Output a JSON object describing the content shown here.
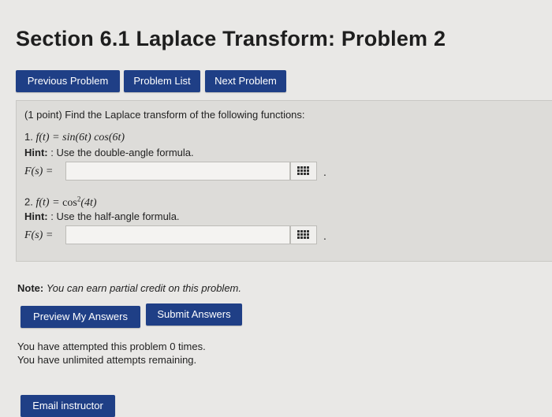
{
  "header": {
    "title": "Section 6.1 Laplace Transform: Problem 2"
  },
  "nav": {
    "previous": "Previous Problem",
    "list": "Problem List",
    "next": "Next Problem"
  },
  "problem": {
    "statement": "(1 point) Find the Laplace transform of the following functions:",
    "parts": [
      {
        "number": "1.",
        "function_lhs": "f(t) =",
        "function_rhs": "sin(6t) cos(6t)",
        "hint_label": "Hint:",
        "hint_text": ": Use the double-angle formula.",
        "answer_label": "F(s) =",
        "answer_value": ""
      },
      {
        "number": "2.",
        "function_lhs": "f(t) =",
        "function_rhs_base": "cos",
        "function_rhs_exp": "2",
        "function_rhs_arg": "(4t)",
        "hint_label": "Hint:",
        "hint_text": ": Use the half-angle formula.",
        "answer_label": "F(s) =",
        "answer_value": ""
      }
    ],
    "trailing_period": "."
  },
  "note": {
    "label": "Note:",
    "text": "You can earn partial credit on this problem."
  },
  "actions": {
    "preview": "Preview My Answers",
    "submit": "Submit Answers"
  },
  "attempts": {
    "line1": "You have attempted this problem 0 times.",
    "line2": "You have unlimited attempts remaining."
  },
  "footer": {
    "email": "Email instructor"
  },
  "colors": {
    "button_bg": "#1f3f86",
    "button_text": "#ffffff",
    "panel_bg": "#dddcd9"
  },
  "icons": {
    "equation_editor": "grid-icon"
  }
}
